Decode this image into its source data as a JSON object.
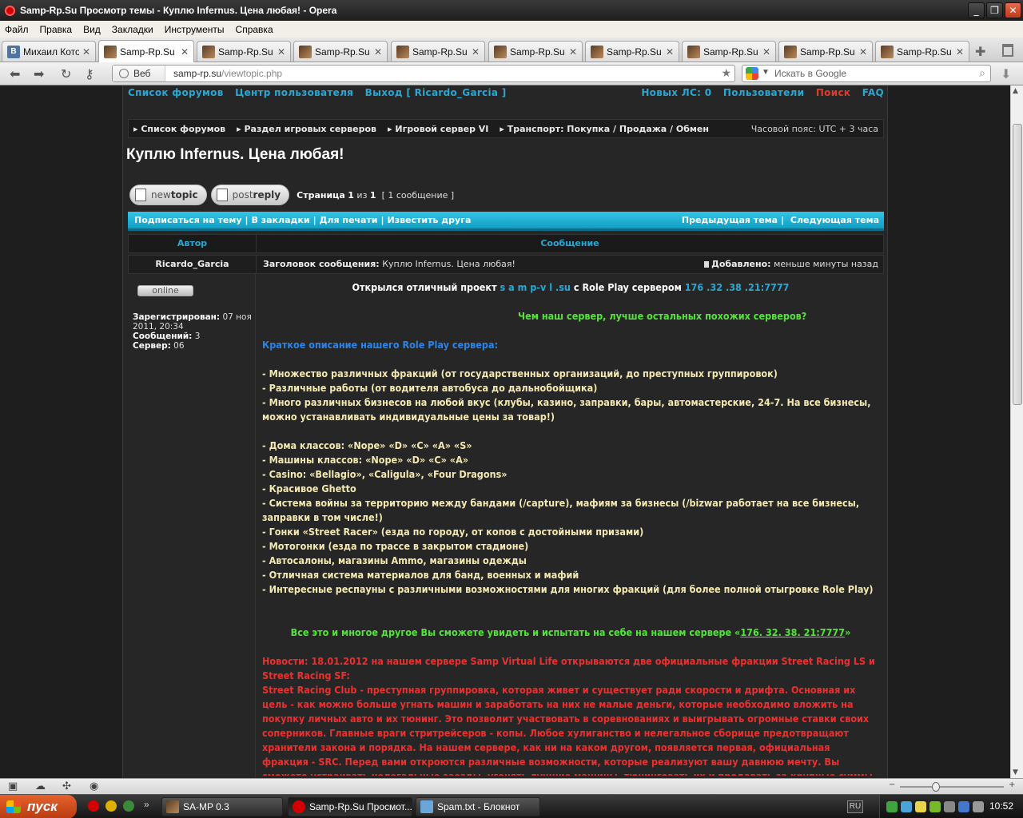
{
  "window": {
    "title": "Samp-Rp.Su Просмотр темы - Куплю Infernus. Цена любая! - Opera"
  },
  "menu": [
    "Файл",
    "Правка",
    "Вид",
    "Закладки",
    "Инструменты",
    "Справка"
  ],
  "tabs": [
    {
      "label": "Михаил Котов",
      "icon": "vk-icon"
    },
    {
      "label": "Samp-Rp.Su П...",
      "icon": "forum-favicon",
      "active": true
    },
    {
      "label": "Samp-Rp.Su H...",
      "icon": "forum-favicon"
    },
    {
      "label": "Samp-Rp.Su H...",
      "icon": "forum-favicon"
    },
    {
      "label": "Samp-Rp.Su H...",
      "icon": "forum-favicon"
    },
    {
      "label": "Samp-Rp.Su ...",
      "icon": "forum-favicon"
    },
    {
      "label": "Samp-Rp.Su ...",
      "icon": "forum-favicon"
    },
    {
      "label": "Samp-Rp.Su ...",
      "icon": "forum-favicon"
    },
    {
      "label": "Samp-Rp.Su ...",
      "icon": "forum-favicon"
    },
    {
      "label": "Samp-Rp.Su ...",
      "icon": "forum-favicon"
    }
  ],
  "address": {
    "badge": "Веб",
    "host": "samp-rp.su",
    "path": "/viewtopic.php"
  },
  "search": {
    "placeholder": "Искать в Google"
  },
  "forum": {
    "toplinks_left": [
      "Список форумов",
      "Центр пользователя",
      "Выход [ Ricardo_Garcia ]"
    ],
    "toplinks_right": [
      "Новых ЛС: 0",
      "Пользователи",
      "Поиск",
      "FAQ"
    ],
    "breadcrumbs": [
      "Список форумов",
      "Раздел игровых серверов",
      "Игровой сервер VI",
      "Транспорт: Покупка / Продажа / Обмен"
    ],
    "timezone": "Часовой пояс: UTC + 3 часа",
    "topic_title": "Куплю Infernus. Цена любая!",
    "newtopic": {
      "pre": "new",
      "bold": "topic"
    },
    "postreply": {
      "pre": "post",
      "bold": "reply"
    },
    "pagination": {
      "label": "Страница",
      "current": "1",
      "of": "из",
      "total": "1",
      "count": "[ 1 сообщение ]"
    },
    "actions_left": [
      "Подписаться на тему",
      "В закладки",
      "Для печати",
      "Известить друга"
    ],
    "actions_right": [
      "Предыдущая тема",
      "Следующая тема"
    ],
    "col_author": "Автор",
    "col_message": "Сообщение",
    "post": {
      "author": "Ricardo_Garcia",
      "subject_label": "Заголовок сообщения:",
      "subject": "Куплю Infernus. Цена любая!",
      "added_label": "Добавлено:",
      "added": "меньше минуты назад"
    },
    "profile": {
      "status": "online",
      "registered_label": "Зарегистрирован:",
      "registered": "07 ноя 2011, 20:34",
      "posts_label": "Сообщений:",
      "posts": "3",
      "server_label": "Сервер:",
      "server": "06"
    },
    "body": {
      "l1_a": "Открылся отличный проект ",
      "l1_site": "s a m p-v l .su",
      "l1_b": " с Role Play сервером ",
      "l1_ip": "176 .32 .38 .21:7777",
      "l2": "Чем наш сервер, лучше остальных похожих серверов?",
      "l3": "Краткое описание нашего Role Play сервера:",
      "list1": [
        "- Множество различных фракций (от государственных организаций, до преступных группировок)",
        "- Различные работы (от водителя автобуса до дальнобойщика)",
        "- Много различных бизнесов на любой вкус (клубы, казино, заправки, бары, автомастерские, 24-7. На все бизнесы, можно устанавливать индивидуальные цены за товар!)"
      ],
      "list2": [
        "- Дома классов: «Nope» «D» «C» «A» «S»",
        "- Машины классов: «Nope» «D» «C» «A»",
        "- Casino: «Bellagio», «Caligula», «Four Dragons»",
        "- Красивое Ghetto",
        "- Система войны за территорию между бандами (/capture), мафиям за бизнесы (/bizwar работает на все бизнесы, заправки в том числе!)",
        "- Гонки «Street Racer» (езда по городу, от копов с достойными призами)",
        "- Мотогонки (езда по трассе в закрытом стадионе)",
        "- Автосалоны, магазины Ammo, магазины одежды",
        "- Отличная система материалов для банд, военных и мафий",
        "- Интересные респауны с различными возможностями для многих фракций (для более полной отыгровке Role Play)"
      ],
      "l4_a": "Все это и многое другое Вы сможете увидеть и испытать на себе на нашем сервере «",
      "l4_ip": "176. 32. 38. 21:7777",
      "l4_b": "»",
      "news": "Новости: 18.01.2012 на нашем сервере Samp Virtual Life открываются две официальные фракции Street Racing LS и Street Racing SF:",
      "news2": "Street Racing Club - преступная группировка, которая живет и существует ради скорости и дрифта. Основная их цель - как можно больше угнать машин и заработать на них не малые деньги, которые необходимо вложить на покупку личных авто и их тюнинг. Это позволит участвовать в соревнованиях и выигрывать огромные ставки своих соперников. Главные враги стритрейсеров - копы. Любое хулиганство и нелегальное сборище предотвращают хранители закона и порядка. На нашем сервере, как ни на каком другом, появляется первая, официальная фракция - SRC. Перед вами откроются различные возможности, которые реализуют вашу давнюю мечту. Вы сможете устраивать нелегальные заезды, угонять лучшие машины, тюнинговать их и продавать за крупные суммы денег."
    }
  },
  "taskbar": {
    "start": "пуск",
    "tasks": [
      "SA-MP 0.3",
      "Samp-Rp.Su Просмот...",
      "Spam.txt - Блокнот"
    ],
    "lang": "RU",
    "clock": "10:52"
  }
}
